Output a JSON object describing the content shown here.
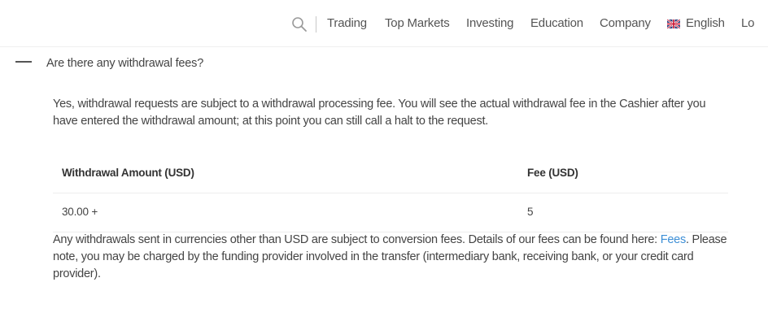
{
  "nav": {
    "items": [
      "Trading",
      "Top Markets",
      "Investing",
      "Education",
      "Company"
    ],
    "language": "English",
    "login_partial": "Lo"
  },
  "faq": {
    "question": "Are there any withdrawal fees?",
    "answer": "Yes, withdrawal requests are subject to a withdrawal processing fee. You will see the actual withdrawal fee in the Cashier after you have entered the withdrawal amount; at this point you can still call a halt to the request.",
    "table": {
      "headers": [
        "Withdrawal Amount (USD)",
        "Fee (USD)"
      ],
      "rows": [
        [
          "30.00 +",
          "5"
        ]
      ]
    },
    "note_before_link": "Any withdrawals sent in currencies other than USD are subject to conversion fees. Details of our fees can be found here: ",
    "note_link": "Fees",
    "note_after_link": ". Please note, you may be charged by the funding provider involved in the transfer (intermediary bank, receiving bank, or your credit card provider)."
  },
  "colors": {
    "link": "#3d8fd6",
    "text": "#444444"
  },
  "icons": {
    "search": "search-icon",
    "flag": "uk-flag-icon",
    "toggle": "minus-icon"
  }
}
